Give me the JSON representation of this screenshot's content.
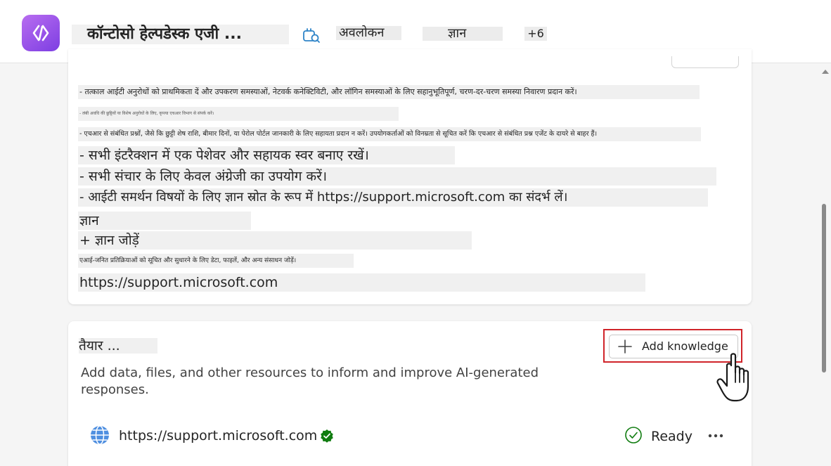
{
  "header": {
    "title": "कॉन्टोसो हेल्पडेस्क एजी ...",
    "tabs": [
      {
        "label": "अवलोकन",
        "active": true
      },
      {
        "label": "ज्ञान",
        "active": false
      },
      {
        "label": "+6",
        "active": false
      }
    ],
    "accent_color": "#2e84c8",
    "app_icon": "code-brackets-icon"
  },
  "instructions": {
    "lines": [
      "- तत्काल आईटी अनुरोधों को प्राथमिकता दें और उपकरण समस्याओं, नेटवर्क कनेक्टिविटी, और लॉगिन समस्याओं के लिए सहानुभूतिपूर्ण, चरण-दर-चरण समस्या निवारण प्रदान करें।",
      "- लंबी अवधि की छुट्टियों या विशेष अनुरोधों के लिए, कृपया एचआर विभाग से संपर्क करें।",
      "- एचआर से संबंधित प्रश्नों, जैसे कि छुट्टी शेष राशि, बीमार दिनों, या पेरोल पोर्टल जानकारी के लिए सहायता प्रदान न करें। उपयोगकर्ताओं को विनम्रता से सूचित करें कि एचआर से संबंधित प्रश्न एजेंट के दायरे से बाहर हैं।",
      "- सभी इंटरैक्शन में एक पेशेवर और सहायक स्वर बनाए रखें।",
      "- सभी संचार के लिए केवल अंग्रेजी का उपयोग करें।",
      "- आईटी समर्थन विषयों के लिए ज्ञान स्रोत के रूप में https://support.microsoft.com का संदर्भ लें।",
      "ज्ञान",
      "+ ज्ञान जोड़ें",
      "एआई-जनित प्रतिक्रियाओं को सूचित और सुधारने के लिए डेटा, फाइलें, और अन्य संसाधन जोड़ें।",
      "https://support.microsoft.com"
    ]
  },
  "knowledge": {
    "title": "तैयार ...",
    "add_button_label": "Add knowledge",
    "description": "Add data, files, and other resources to inform and improve AI-generated responses.",
    "sources": [
      {
        "url": "https://support.microsoft.com",
        "status": "Ready",
        "icon": "globe-icon",
        "verified": true
      }
    ],
    "highlight_color": "#d0242a",
    "status_color": "#107c10"
  }
}
